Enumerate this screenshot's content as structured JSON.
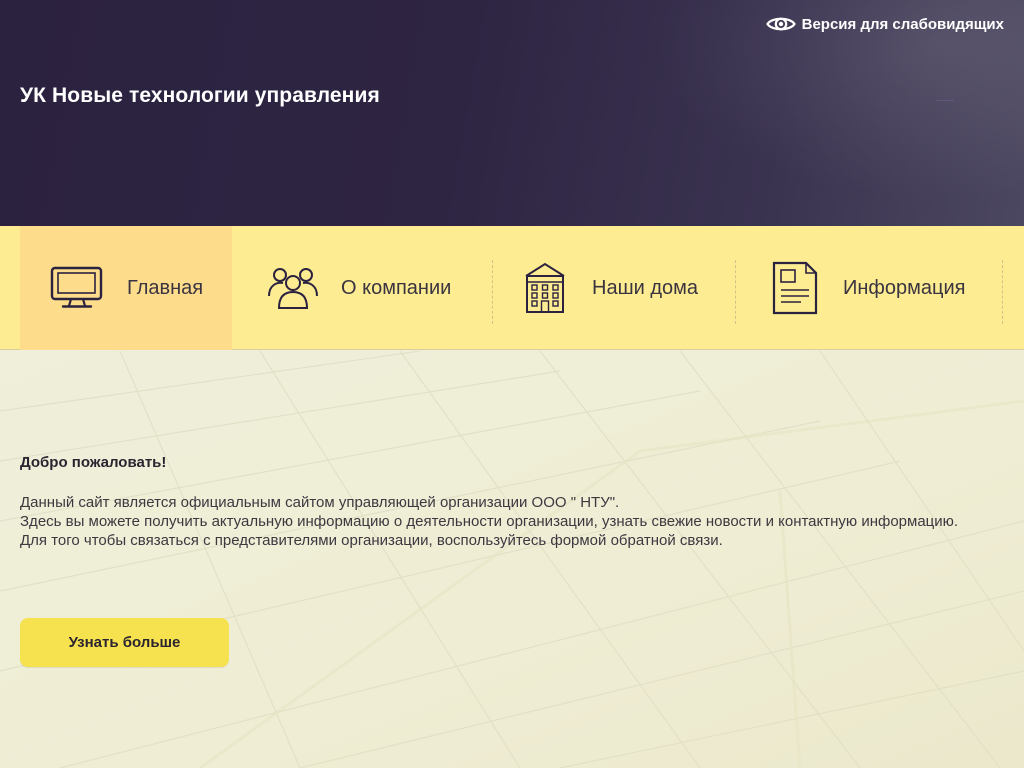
{
  "header": {
    "vision_label": "Версия для слабовидящих",
    "vision_icon": "eye-icon",
    "title": "УК Новые технологии управления"
  },
  "nav": {
    "items": [
      {
        "label": "Главная",
        "icon": "monitor-icon",
        "active": true
      },
      {
        "label": "О компании",
        "icon": "people-icon",
        "active": false
      },
      {
        "label": "Наши дома",
        "icon": "building-icon",
        "active": false
      },
      {
        "label": "Информация",
        "icon": "document-icon",
        "active": false
      }
    ]
  },
  "hero": {
    "welcome": "Добро пожаловать!",
    "lines": [
      "Данный сайт является официальным сайтом управляющей организации ООО \" НТУ\".",
      "Здесь вы можете получить актуальную информацию о деятельности организации, узнать свежие новости и контактную информацию.",
      "Для того чтобы связаться с представителями организации, воспользуйтесь формой обратной связи."
    ],
    "button_label": "Узнать больше"
  },
  "colors": {
    "header_bg": "#2b2240",
    "nav_bg": "#fdec92",
    "nav_active_bg": "#fddc8c",
    "button_bg": "#f6e24e",
    "text_dark": "#3a3440"
  }
}
